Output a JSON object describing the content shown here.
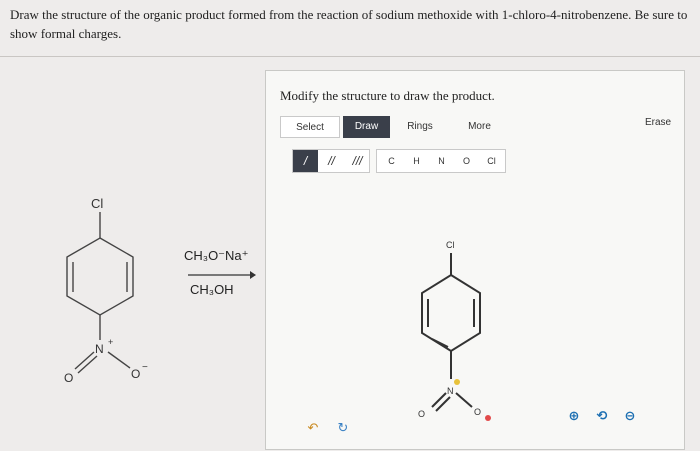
{
  "question": {
    "text": "Draw the structure of the organic product formed from the reaction of sodium methoxide with 1-chloro-4-nitrobenzene. Be sure to show formal charges."
  },
  "reactant": {
    "cl_label": "Cl",
    "n_label": "N",
    "n_charge": "+",
    "o1_label": "O",
    "o2_label": "O",
    "o2_charge": "−"
  },
  "reagents": {
    "base": "CH₃O⁻Na⁺",
    "solvent": "CH₃OH"
  },
  "editor": {
    "instruction": "Modify the structure to draw the product.",
    "tabs": {
      "select": "Select",
      "draw": "Draw",
      "rings": "Rings",
      "more": "More",
      "erase": "Erase"
    },
    "bond_tools": [
      "/",
      "//",
      "///"
    ],
    "atom_tools": [
      "C",
      "H",
      "N",
      "O",
      "Cl"
    ],
    "canvas": {
      "cl_label": "Cl",
      "n_label": "N",
      "o1_label": "O",
      "o2_label": "O"
    },
    "undo_icon": "undo-icon",
    "redo_icon": "redo-icon",
    "zoom_in_icon": "zoom-in-icon",
    "reset_icon": "reset-icon",
    "zoom_out_icon": "zoom-out-icon"
  },
  "colors": {
    "accent_dark": "#3a3f4a",
    "zoom_blue": "#1c6fb2",
    "charge_yellow": "#e8c23a",
    "charge_red": "#e24a4a"
  }
}
